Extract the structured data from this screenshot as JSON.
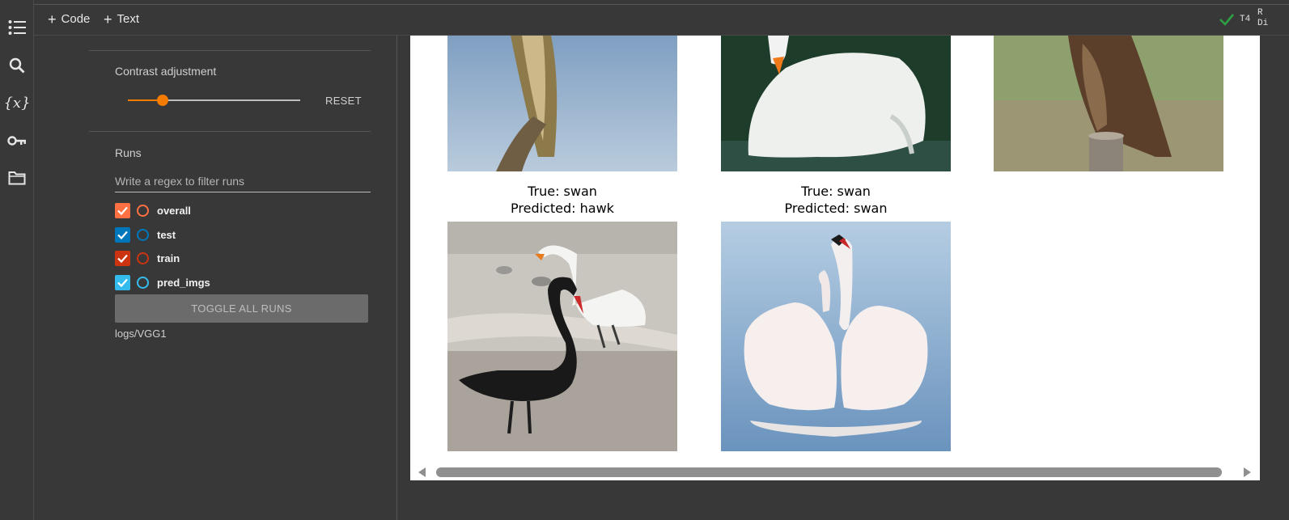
{
  "toolbar": {
    "code_label": "Code",
    "text_label": "Text",
    "runtime": "T4",
    "runtime_extra": "R\nDi",
    "status_color": "#2ea043"
  },
  "rail": {
    "icons": [
      "toc-icon",
      "search-icon",
      "variables-icon",
      "key-icon",
      "folder-icon"
    ],
    "variables_glyph": "{x}"
  },
  "panel": {
    "contrast_title": "Contrast adjustment",
    "contrast_value": 0.2,
    "reset_label": "RESET",
    "runs_title": "Runs",
    "filter_placeholder": "Write a regex to filter runs",
    "runs": [
      {
        "name": "overall",
        "color": "#ff7043",
        "checked": true
      },
      {
        "name": "test",
        "color": "#0077bb",
        "checked": true
      },
      {
        "name": "train",
        "color": "#cc3311",
        "checked": true
      },
      {
        "name": "pred_imgs",
        "color": "#33bbee",
        "checked": true
      }
    ],
    "toggle_label": "TOGGLE ALL RUNS",
    "logdir": "logs/VGG1"
  },
  "output": {
    "top_images": [
      "hawk-on-branch-image",
      "swan-swimming-image",
      "hawk-on-post-image"
    ],
    "predictions": [
      {
        "true_label": "True: swan",
        "predicted_label": "Predicted: hawk",
        "image": "black-and-white-swans-image"
      },
      {
        "true_label": "True: swan",
        "predicted_label": "Predicted: swan",
        "image": "white-swan-wings-image"
      }
    ]
  }
}
